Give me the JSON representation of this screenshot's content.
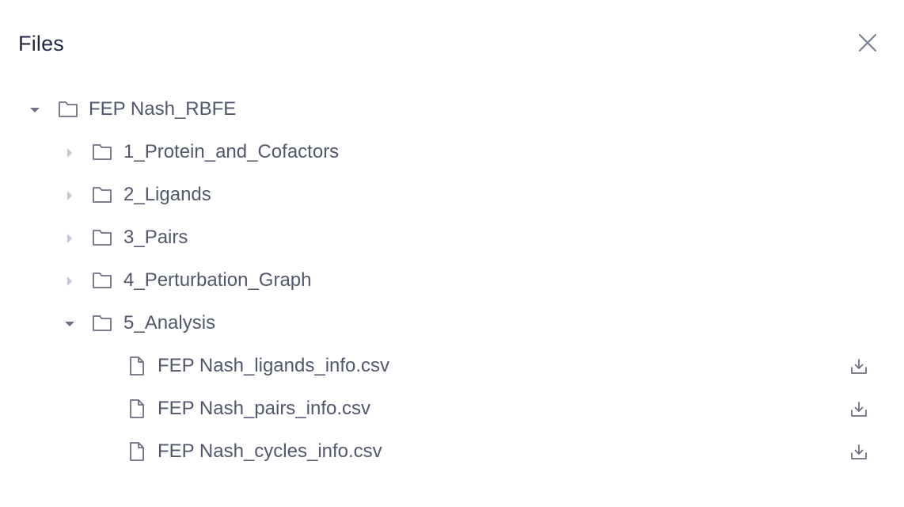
{
  "dialog": {
    "title": "Files"
  },
  "tree": {
    "root": {
      "label": "FEP Nash_RBFE",
      "expanded": true
    },
    "folders": [
      {
        "label": "1_Protein_and_Cofactors",
        "expanded": false
      },
      {
        "label": "2_Ligands",
        "expanded": false
      },
      {
        "label": "3_Pairs",
        "expanded": false
      },
      {
        "label": "4_Perturbation_Graph",
        "expanded": false
      },
      {
        "label": "5_Analysis",
        "expanded": true
      }
    ],
    "files": [
      {
        "label": "FEP Nash_ligands_info.csv",
        "icon": "file-icon",
        "action_icon": "download-icon"
      },
      {
        "label": "FEP Nash_pairs_info.csv",
        "icon": "file-icon",
        "action_icon": "download-icon"
      },
      {
        "label": "FEP Nash_cycles_info.csv",
        "icon": "file-icon",
        "action_icon": "download-icon"
      }
    ]
  },
  "colors": {
    "title": "#1f2544",
    "text": "#51576c",
    "icon": "#6b7083",
    "caret_expanded": "#6b7083",
    "caret_collapsed": "#c4c7d4"
  }
}
